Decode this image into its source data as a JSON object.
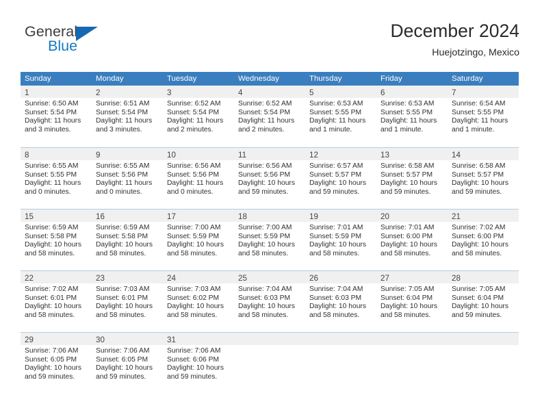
{
  "brand": {
    "name_primary": "General",
    "name_secondary": "Blue",
    "accent_color": "#1479c4",
    "triangle_color": "#1668b3"
  },
  "header": {
    "title": "December 2024",
    "subtitle": "Huejotzingo, Mexico"
  },
  "calendar": {
    "header_bg": "#3a7ebf",
    "daynum_bg": "#f0f0f0",
    "weekday_headers": [
      "Sunday",
      "Monday",
      "Tuesday",
      "Wednesday",
      "Thursday",
      "Friday",
      "Saturday"
    ],
    "weeks": [
      [
        {
          "day": "1",
          "sunrise": "Sunrise: 6:50 AM",
          "sunset": "Sunset: 5:54 PM",
          "daylight_line1": "Daylight: 11 hours",
          "daylight_line2": "and 3 minutes."
        },
        {
          "day": "2",
          "sunrise": "Sunrise: 6:51 AM",
          "sunset": "Sunset: 5:54 PM",
          "daylight_line1": "Daylight: 11 hours",
          "daylight_line2": "and 3 minutes."
        },
        {
          "day": "3",
          "sunrise": "Sunrise: 6:52 AM",
          "sunset": "Sunset: 5:54 PM",
          "daylight_line1": "Daylight: 11 hours",
          "daylight_line2": "and 2 minutes."
        },
        {
          "day": "4",
          "sunrise": "Sunrise: 6:52 AM",
          "sunset": "Sunset: 5:54 PM",
          "daylight_line1": "Daylight: 11 hours",
          "daylight_line2": "and 2 minutes."
        },
        {
          "day": "5",
          "sunrise": "Sunrise: 6:53 AM",
          "sunset": "Sunset: 5:55 PM",
          "daylight_line1": "Daylight: 11 hours",
          "daylight_line2": "and 1 minute."
        },
        {
          "day": "6",
          "sunrise": "Sunrise: 6:53 AM",
          "sunset": "Sunset: 5:55 PM",
          "daylight_line1": "Daylight: 11 hours",
          "daylight_line2": "and 1 minute."
        },
        {
          "day": "7",
          "sunrise": "Sunrise: 6:54 AM",
          "sunset": "Sunset: 5:55 PM",
          "daylight_line1": "Daylight: 11 hours",
          "daylight_line2": "and 1 minute."
        }
      ],
      [
        {
          "day": "8",
          "sunrise": "Sunrise: 6:55 AM",
          "sunset": "Sunset: 5:55 PM",
          "daylight_line1": "Daylight: 11 hours",
          "daylight_line2": "and 0 minutes."
        },
        {
          "day": "9",
          "sunrise": "Sunrise: 6:55 AM",
          "sunset": "Sunset: 5:56 PM",
          "daylight_line1": "Daylight: 11 hours",
          "daylight_line2": "and 0 minutes."
        },
        {
          "day": "10",
          "sunrise": "Sunrise: 6:56 AM",
          "sunset": "Sunset: 5:56 PM",
          "daylight_line1": "Daylight: 11 hours",
          "daylight_line2": "and 0 minutes."
        },
        {
          "day": "11",
          "sunrise": "Sunrise: 6:56 AM",
          "sunset": "Sunset: 5:56 PM",
          "daylight_line1": "Daylight: 10 hours",
          "daylight_line2": "and 59 minutes."
        },
        {
          "day": "12",
          "sunrise": "Sunrise: 6:57 AM",
          "sunset": "Sunset: 5:57 PM",
          "daylight_line1": "Daylight: 10 hours",
          "daylight_line2": "and 59 minutes."
        },
        {
          "day": "13",
          "sunrise": "Sunrise: 6:58 AM",
          "sunset": "Sunset: 5:57 PM",
          "daylight_line1": "Daylight: 10 hours",
          "daylight_line2": "and 59 minutes."
        },
        {
          "day": "14",
          "sunrise": "Sunrise: 6:58 AM",
          "sunset": "Sunset: 5:57 PM",
          "daylight_line1": "Daylight: 10 hours",
          "daylight_line2": "and 59 minutes."
        }
      ],
      [
        {
          "day": "15",
          "sunrise": "Sunrise: 6:59 AM",
          "sunset": "Sunset: 5:58 PM",
          "daylight_line1": "Daylight: 10 hours",
          "daylight_line2": "and 58 minutes."
        },
        {
          "day": "16",
          "sunrise": "Sunrise: 6:59 AM",
          "sunset": "Sunset: 5:58 PM",
          "daylight_line1": "Daylight: 10 hours",
          "daylight_line2": "and 58 minutes."
        },
        {
          "day": "17",
          "sunrise": "Sunrise: 7:00 AM",
          "sunset": "Sunset: 5:59 PM",
          "daylight_line1": "Daylight: 10 hours",
          "daylight_line2": "and 58 minutes."
        },
        {
          "day": "18",
          "sunrise": "Sunrise: 7:00 AM",
          "sunset": "Sunset: 5:59 PM",
          "daylight_line1": "Daylight: 10 hours",
          "daylight_line2": "and 58 minutes."
        },
        {
          "day": "19",
          "sunrise": "Sunrise: 7:01 AM",
          "sunset": "Sunset: 5:59 PM",
          "daylight_line1": "Daylight: 10 hours",
          "daylight_line2": "and 58 minutes."
        },
        {
          "day": "20",
          "sunrise": "Sunrise: 7:01 AM",
          "sunset": "Sunset: 6:00 PM",
          "daylight_line1": "Daylight: 10 hours",
          "daylight_line2": "and 58 minutes."
        },
        {
          "day": "21",
          "sunrise": "Sunrise: 7:02 AM",
          "sunset": "Sunset: 6:00 PM",
          "daylight_line1": "Daylight: 10 hours",
          "daylight_line2": "and 58 minutes."
        }
      ],
      [
        {
          "day": "22",
          "sunrise": "Sunrise: 7:02 AM",
          "sunset": "Sunset: 6:01 PM",
          "daylight_line1": "Daylight: 10 hours",
          "daylight_line2": "and 58 minutes."
        },
        {
          "day": "23",
          "sunrise": "Sunrise: 7:03 AM",
          "sunset": "Sunset: 6:01 PM",
          "daylight_line1": "Daylight: 10 hours",
          "daylight_line2": "and 58 minutes."
        },
        {
          "day": "24",
          "sunrise": "Sunrise: 7:03 AM",
          "sunset": "Sunset: 6:02 PM",
          "daylight_line1": "Daylight: 10 hours",
          "daylight_line2": "and 58 minutes."
        },
        {
          "day": "25",
          "sunrise": "Sunrise: 7:04 AM",
          "sunset": "Sunset: 6:03 PM",
          "daylight_line1": "Daylight: 10 hours",
          "daylight_line2": "and 58 minutes."
        },
        {
          "day": "26",
          "sunrise": "Sunrise: 7:04 AM",
          "sunset": "Sunset: 6:03 PM",
          "daylight_line1": "Daylight: 10 hours",
          "daylight_line2": "and 58 minutes."
        },
        {
          "day": "27",
          "sunrise": "Sunrise: 7:05 AM",
          "sunset": "Sunset: 6:04 PM",
          "daylight_line1": "Daylight: 10 hours",
          "daylight_line2": "and 58 minutes."
        },
        {
          "day": "28",
          "sunrise": "Sunrise: 7:05 AM",
          "sunset": "Sunset: 6:04 PM",
          "daylight_line1": "Daylight: 10 hours",
          "daylight_line2": "and 59 minutes."
        }
      ],
      [
        {
          "day": "29",
          "sunrise": "Sunrise: 7:06 AM",
          "sunset": "Sunset: 6:05 PM",
          "daylight_line1": "Daylight: 10 hours",
          "daylight_line2": "and 59 minutes."
        },
        {
          "day": "30",
          "sunrise": "Sunrise: 7:06 AM",
          "sunset": "Sunset: 6:05 PM",
          "daylight_line1": "Daylight: 10 hours",
          "daylight_line2": "and 59 minutes."
        },
        {
          "day": "31",
          "sunrise": "Sunrise: 7:06 AM",
          "sunset": "Sunset: 6:06 PM",
          "daylight_line1": "Daylight: 10 hours",
          "daylight_line2": "and 59 minutes."
        },
        {
          "day": "",
          "sunrise": "",
          "sunset": "",
          "daylight_line1": "",
          "daylight_line2": ""
        },
        {
          "day": "",
          "sunrise": "",
          "sunset": "",
          "daylight_line1": "",
          "daylight_line2": ""
        },
        {
          "day": "",
          "sunrise": "",
          "sunset": "",
          "daylight_line1": "",
          "daylight_line2": ""
        },
        {
          "day": "",
          "sunrise": "",
          "sunset": "",
          "daylight_line1": "",
          "daylight_line2": ""
        }
      ]
    ]
  }
}
